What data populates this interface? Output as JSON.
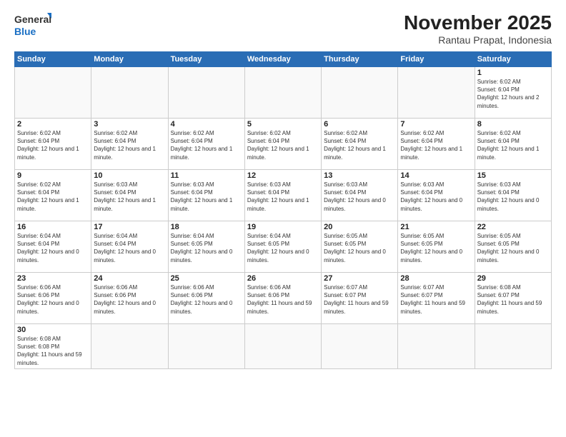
{
  "header": {
    "logo_general": "General",
    "logo_blue": "Blue",
    "month_year": "November 2025",
    "location": "Rantau Prapat, Indonesia"
  },
  "weekdays": [
    "Sunday",
    "Monday",
    "Tuesday",
    "Wednesday",
    "Thursday",
    "Friday",
    "Saturday"
  ],
  "weeks": [
    [
      {
        "day": "",
        "info": ""
      },
      {
        "day": "",
        "info": ""
      },
      {
        "day": "",
        "info": ""
      },
      {
        "day": "",
        "info": ""
      },
      {
        "day": "",
        "info": ""
      },
      {
        "day": "",
        "info": ""
      },
      {
        "day": "1",
        "info": "Sunrise: 6:02 AM\nSunset: 6:04 PM\nDaylight: 12 hours and 2 minutes."
      }
    ],
    [
      {
        "day": "2",
        "info": "Sunrise: 6:02 AM\nSunset: 6:04 PM\nDaylight: 12 hours and 1 minute."
      },
      {
        "day": "3",
        "info": "Sunrise: 6:02 AM\nSunset: 6:04 PM\nDaylight: 12 hours and 1 minute."
      },
      {
        "day": "4",
        "info": "Sunrise: 6:02 AM\nSunset: 6:04 PM\nDaylight: 12 hours and 1 minute."
      },
      {
        "day": "5",
        "info": "Sunrise: 6:02 AM\nSunset: 6:04 PM\nDaylight: 12 hours and 1 minute."
      },
      {
        "day": "6",
        "info": "Sunrise: 6:02 AM\nSunset: 6:04 PM\nDaylight: 12 hours and 1 minute."
      },
      {
        "day": "7",
        "info": "Sunrise: 6:02 AM\nSunset: 6:04 PM\nDaylight: 12 hours and 1 minute."
      },
      {
        "day": "8",
        "info": "Sunrise: 6:02 AM\nSunset: 6:04 PM\nDaylight: 12 hours and 1 minute."
      }
    ],
    [
      {
        "day": "9",
        "info": "Sunrise: 6:02 AM\nSunset: 6:04 PM\nDaylight: 12 hours and 1 minute."
      },
      {
        "day": "10",
        "info": "Sunrise: 6:03 AM\nSunset: 6:04 PM\nDaylight: 12 hours and 1 minute."
      },
      {
        "day": "11",
        "info": "Sunrise: 6:03 AM\nSunset: 6:04 PM\nDaylight: 12 hours and 1 minute."
      },
      {
        "day": "12",
        "info": "Sunrise: 6:03 AM\nSunset: 6:04 PM\nDaylight: 12 hours and 1 minute."
      },
      {
        "day": "13",
        "info": "Sunrise: 6:03 AM\nSunset: 6:04 PM\nDaylight: 12 hours and 0 minutes."
      },
      {
        "day": "14",
        "info": "Sunrise: 6:03 AM\nSunset: 6:04 PM\nDaylight: 12 hours and 0 minutes."
      },
      {
        "day": "15",
        "info": "Sunrise: 6:03 AM\nSunset: 6:04 PM\nDaylight: 12 hours and 0 minutes."
      }
    ],
    [
      {
        "day": "16",
        "info": "Sunrise: 6:04 AM\nSunset: 6:04 PM\nDaylight: 12 hours and 0 minutes."
      },
      {
        "day": "17",
        "info": "Sunrise: 6:04 AM\nSunset: 6:04 PM\nDaylight: 12 hours and 0 minutes."
      },
      {
        "day": "18",
        "info": "Sunrise: 6:04 AM\nSunset: 6:05 PM\nDaylight: 12 hours and 0 minutes."
      },
      {
        "day": "19",
        "info": "Sunrise: 6:04 AM\nSunset: 6:05 PM\nDaylight: 12 hours and 0 minutes."
      },
      {
        "day": "20",
        "info": "Sunrise: 6:05 AM\nSunset: 6:05 PM\nDaylight: 12 hours and 0 minutes."
      },
      {
        "day": "21",
        "info": "Sunrise: 6:05 AM\nSunset: 6:05 PM\nDaylight: 12 hours and 0 minutes."
      },
      {
        "day": "22",
        "info": "Sunrise: 6:05 AM\nSunset: 6:05 PM\nDaylight: 12 hours and 0 minutes."
      }
    ],
    [
      {
        "day": "23",
        "info": "Sunrise: 6:06 AM\nSunset: 6:06 PM\nDaylight: 12 hours and 0 minutes."
      },
      {
        "day": "24",
        "info": "Sunrise: 6:06 AM\nSunset: 6:06 PM\nDaylight: 12 hours and 0 minutes."
      },
      {
        "day": "25",
        "info": "Sunrise: 6:06 AM\nSunset: 6:06 PM\nDaylight: 12 hours and 0 minutes."
      },
      {
        "day": "26",
        "info": "Sunrise: 6:06 AM\nSunset: 6:06 PM\nDaylight: 11 hours and 59 minutes."
      },
      {
        "day": "27",
        "info": "Sunrise: 6:07 AM\nSunset: 6:07 PM\nDaylight: 11 hours and 59 minutes."
      },
      {
        "day": "28",
        "info": "Sunrise: 6:07 AM\nSunset: 6:07 PM\nDaylight: 11 hours and 59 minutes."
      },
      {
        "day": "29",
        "info": "Sunrise: 6:08 AM\nSunset: 6:07 PM\nDaylight: 11 hours and 59 minutes."
      }
    ],
    [
      {
        "day": "30",
        "info": "Sunrise: 6:08 AM\nSunset: 6:08 PM\nDaylight: 11 hours and 59 minutes."
      },
      {
        "day": "",
        "info": ""
      },
      {
        "day": "",
        "info": ""
      },
      {
        "day": "",
        "info": ""
      },
      {
        "day": "",
        "info": ""
      },
      {
        "day": "",
        "info": ""
      },
      {
        "day": "",
        "info": ""
      }
    ]
  ]
}
